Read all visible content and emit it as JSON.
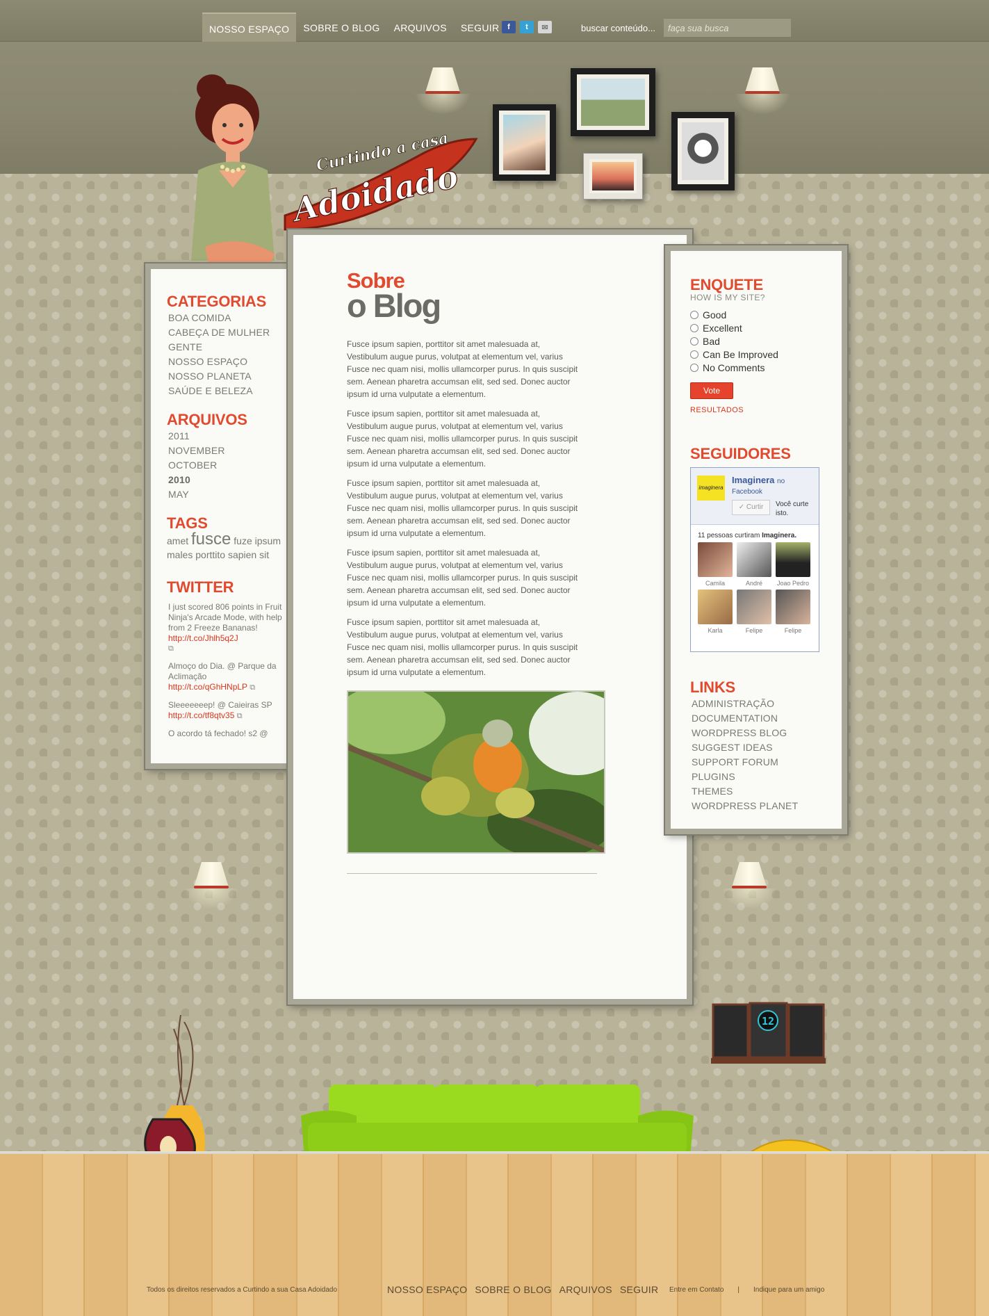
{
  "nav": {
    "items": [
      "NOSSO ESPAÇO",
      "SOBRE O BLOG",
      "ARQUIVOS",
      "SEGUIR"
    ],
    "social": [
      "facebook-icon",
      "twitter-icon",
      "mail-icon"
    ],
    "search_label": "buscar conteúdo...",
    "search_placeholder": "faça sua busca"
  },
  "logo": {
    "line1": "Curtindo a casa",
    "line2": "Adoidado"
  },
  "left": {
    "categorias_title": "CATEGORIAS",
    "categorias": [
      "BOA COMIDA",
      "CABEÇA DE MULHER",
      "GENTE",
      "NOSSO ESPAÇO",
      "NOSSO PLANETA",
      "SAÚDE E BELEZA"
    ],
    "arquivos_title": "ARQUIVOS",
    "arquivos": [
      "2011",
      "NOVEMBER",
      "OCTOBER",
      "2010",
      "MAY"
    ],
    "tags_title": "TAGS",
    "tags": [
      "amet",
      "fusce",
      "fuze",
      "ipsum",
      "males",
      "porttito",
      "sapien",
      "sit"
    ],
    "twitter_title": "TWITTER",
    "tweets": [
      {
        "text": "I just scored 806 points in Fruit Ninja's Arcade Mode, with help from 2 Freeze Bananas!",
        "link": "http://t.co/Jhlh5q2J"
      },
      {
        "text": "Almoço do Dia. @ Parque da Aclimação",
        "link": "http://t.co/qGhHNpLP"
      },
      {
        "text": "Sleeeeeeep!  @ Caieiras SP",
        "link": "http://t.co/tf8qtv35"
      },
      {
        "text": "O acordo tá fechado! s2 @",
        "link": ""
      }
    ]
  },
  "main": {
    "title_line1": "Sobre",
    "title_line2": "o Blog",
    "paragraphs": [
      "Fusce ipsum sapien, porttitor sit amet malesuada at, Vestibulum augue purus, volutpat at elementum vel, varius Fusce nec quam nisi, mollis ullamcorper purus. In quis suscipit sem. Aenean pharetra accumsan elit, sed sed. Donec auctor ipsum id urna vulputate a elementum.",
      "Fusce ipsum sapien, porttitor sit amet malesuada at, Vestibulum augue purus, volutpat at elementum vel, varius Fusce nec quam nisi, mollis ullamcorper purus. In quis suscipit sem. Aenean pharetra accumsan elit, sed sed. Donec auctor ipsum id urna vulputate a elementum.",
      "Fusce ipsum sapien, porttitor sit amet malesuada at, Vestibulum augue purus, volutpat at elementum vel, varius Fusce nec quam nisi, mollis ullamcorper purus. In quis suscipit sem. Aenean pharetra accumsan elit, sed sed. Donec auctor ipsum id urna vulputate a elementum.",
      "Fusce ipsum sapien, porttitor sit amet malesuada at, Vestibulum augue purus, volutpat at elementum vel, varius Fusce nec quam nisi, mollis ullamcorper purus. In quis suscipit sem. Aenean pharetra accumsan elit, sed sed. Donec auctor ipsum id urna vulputate a elementum.",
      "Fusce ipsum sapien, porttitor sit amet malesuada at, Vestibulum augue purus, volutpat at elementum vel, varius Fusce nec quam nisi, mollis ullamcorper purus. In quis suscipit sem. Aenean pharetra accumsan elit, sed sed. Donec auctor ipsum id urna vulputate a elementum."
    ]
  },
  "right": {
    "enquete_title": "ENQUETE",
    "enquete_sub": "HOW IS MY SITE?",
    "options": [
      "Good",
      "Excellent",
      "Bad",
      "Can Be Improved",
      "No Comments"
    ],
    "vote": "Vote",
    "results": "RESULTADOS",
    "seguidores_title": "SEGUIDORES",
    "fb": {
      "page": "Imaginera",
      "on": "no",
      "facebook": "Facebook",
      "like": "✓ Curtir",
      "you": "Você curte isto.",
      "count_prefix": "11 pessoas curtiram",
      "count_name": "Imaginera.",
      "fans": [
        "Camila",
        "André",
        "Joao Pedro",
        "Karla",
        "Felipe",
        "Felipe"
      ]
    },
    "links_title": "LINKS",
    "links": [
      "ADMINISTRAÇÃO",
      "DOCUMENTATION",
      "WORDPRESS BLOG",
      "SUGGEST IDEAS",
      "SUPPORT FORUM",
      "PLUGINS",
      "THEMES",
      "WORDPRESS PLANET"
    ]
  },
  "clock": "12",
  "footer": {
    "copyright": "Todos os direitos reservados a Curtindo a sua Casa Adoidado",
    "nav": [
      "NOSSO ESPAÇO",
      "SOBRE O BLOG",
      "ARQUIVOS",
      "SEGUIR"
    ],
    "contact": "Entre em Contato",
    "sep": "|",
    "indique": "Indique para um amigo"
  },
  "colors": {
    "accent": "#e14a2f",
    "panel": "#fafaf6",
    "frame": "#a9a898",
    "sofa": "#8fd21a",
    "floor": "#e2b97a"
  }
}
